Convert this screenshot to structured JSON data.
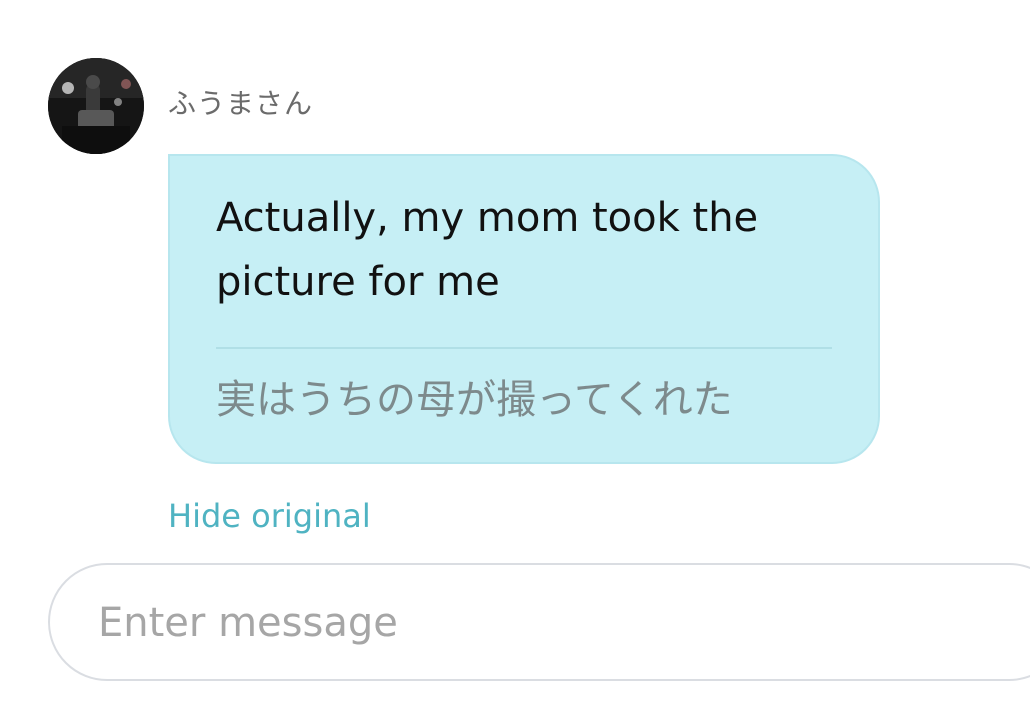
{
  "sender": {
    "name": "ふうまさん",
    "avatar_icon": "user-photo-avatar"
  },
  "message": {
    "translated_text": "Actually, my mom took the picture for me",
    "original_text": "実はうちの母が撮ってくれた",
    "bubble_color": "#c6eff5"
  },
  "actions": {
    "hide_original_label": "Hide original",
    "link_color": "#4fb3c2"
  },
  "composer": {
    "placeholder": "Enter message",
    "value": ""
  }
}
